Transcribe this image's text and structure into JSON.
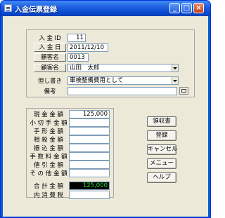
{
  "window": {
    "title": "入金伝票登録"
  },
  "header_form": {
    "nyukin_id": {
      "label": "入 金 ID",
      "value": "11"
    },
    "nyukin_bi": {
      "label": "入 金 日",
      "value": "2011/12/10"
    },
    "kokyaku_mei_code": {
      "label": "顧客名",
      "value": "0013"
    },
    "kokyaku_mei_select": {
      "label": "顧客名",
      "value": "山田　太郎"
    },
    "tadashi_gaki": {
      "label": "但し書き",
      "value": "車検整備費用として"
    },
    "biko": {
      "label": "備考",
      "value": ""
    }
  },
  "amounts": {
    "genkin": {
      "label": "現 金 金 額",
      "value": "125,000"
    },
    "kogitte": {
      "label": "小 切 手 金 額",
      "value": ""
    },
    "tegata": {
      "label": "手 形 金 額",
      "value": ""
    },
    "sosai": {
      "label": "相 殺 金 額",
      "value": ""
    },
    "furikomi": {
      "label": "振 込 金 額",
      "value": ""
    },
    "tesuryo": {
      "label": "手 数 料 金 額",
      "value": ""
    },
    "nebiki": {
      "label": "値 引 金 額",
      "value": ""
    },
    "sonota": {
      "label": "そ の 他 金 額",
      "value": ""
    }
  },
  "totals": {
    "gokei": {
      "label": "合 計 金 額",
      "value": "125,000"
    },
    "shohizei": {
      "label": "内 消 費 税",
      "value": ""
    }
  },
  "buttons": {
    "receipt": "領収書",
    "register": "登録",
    "cancel": "キャンセル",
    "menu": "メニュー",
    "help": "ヘルプ"
  },
  "colors": {
    "titlebar": "#0a5bd8",
    "client_bg": "#ece9d8",
    "total_text": "#2adf3a"
  }
}
